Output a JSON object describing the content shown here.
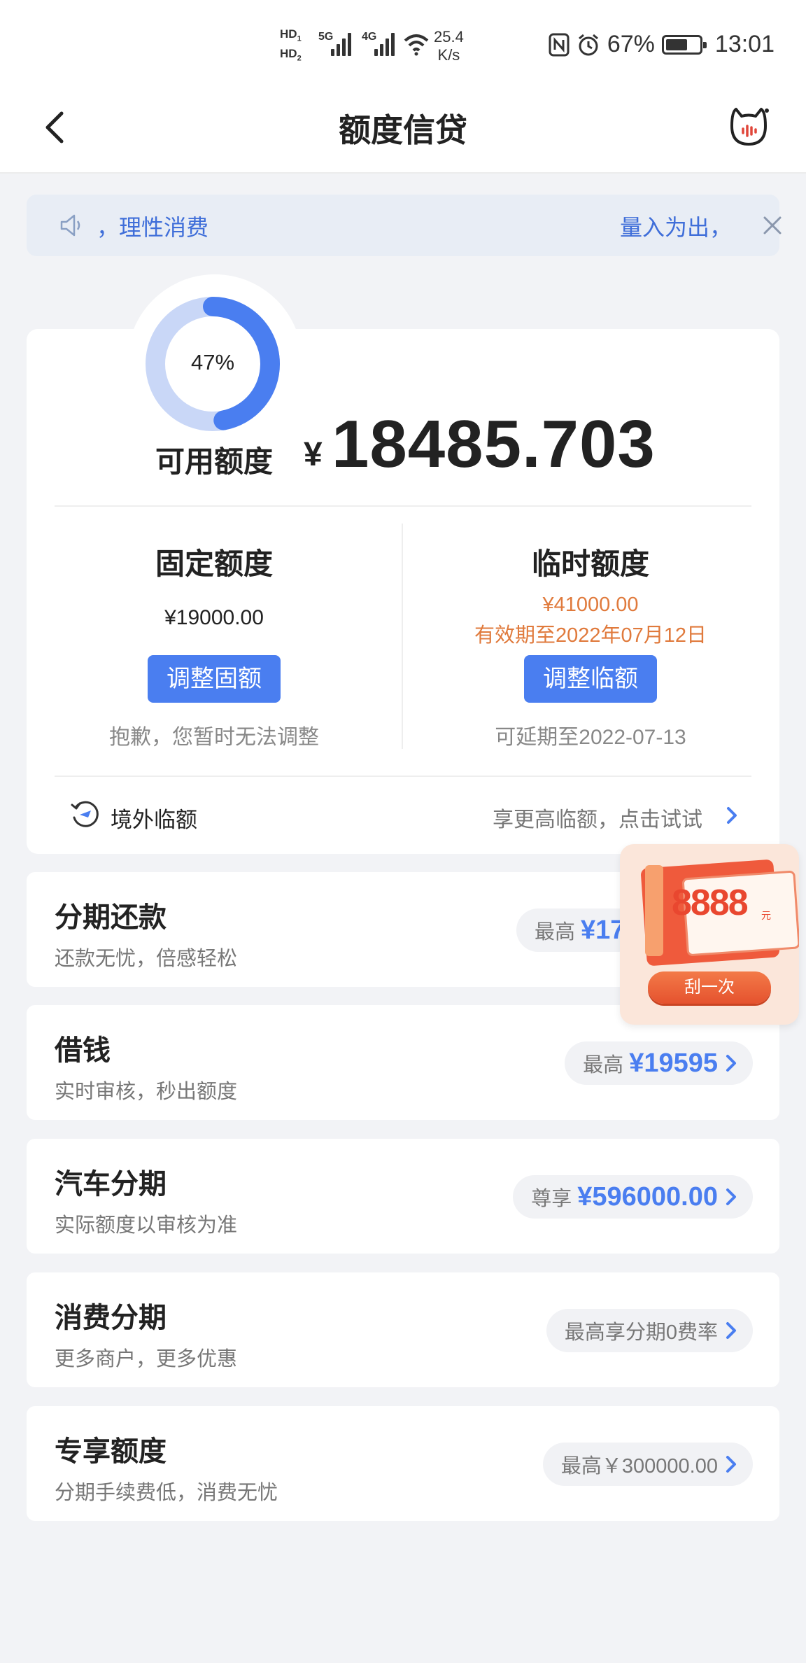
{
  "status_bar": {
    "hd1": "HD",
    "hd1_sub": "1",
    "hd2": "HD",
    "hd2_sub": "2",
    "net1": "5G",
    "net2": "4G",
    "speed_value": "25.4",
    "speed_unit": "K/s",
    "battery": "67%",
    "time": "13:01"
  },
  "nav": {
    "title": "额度信贷"
  },
  "notice": {
    "text_left": "，理性消费",
    "text_right": "量入为出，"
  },
  "credit": {
    "usage_percent": "47%",
    "usage_fraction": 0.47,
    "available_label": "可用额度",
    "currency_symbol": "¥",
    "available_amount": "18485.703",
    "fixed": {
      "title": "固定额度",
      "amount": "¥19000.00",
      "button": "调整固额",
      "note": "抱歉，您暂时无法调整"
    },
    "temporary": {
      "title": "临时额度",
      "amount": "¥41000.00",
      "expiry": "有效期至2022年07月12日",
      "button": "调整临额",
      "note": "可延期至2022-07-13"
    },
    "overseas": {
      "label": "境外临额",
      "promo": "享更高临额，点击试试"
    }
  },
  "products": [
    {
      "title": "分期还款",
      "subtitle": "还款无忧，倍感轻松",
      "prefix": "最高",
      "value": "¥17"
    },
    {
      "title": "借钱",
      "subtitle": "实时审核，秒出额度",
      "prefix": "最高",
      "value": "¥19595"
    },
    {
      "title": "汽车分期",
      "subtitle": "实际额度以审核为准",
      "prefix": "尊享",
      "value": "¥596000.00"
    },
    {
      "title": "消费分期",
      "subtitle": "更多商户，更多优惠",
      "text": "最高享分期0费率"
    },
    {
      "title": "专享额度",
      "subtitle": "分期手续费低，消费无忧",
      "text": "最高￥300000.00"
    }
  ],
  "promo": {
    "amount": "8888",
    "unit": "元",
    "button": "刮一次"
  },
  "colors": {
    "accent": "#4a7ef0",
    "orange": "#e07a3c",
    "gauge_track": "#c9d7f7",
    "page_bg": "#f2f3f6"
  }
}
